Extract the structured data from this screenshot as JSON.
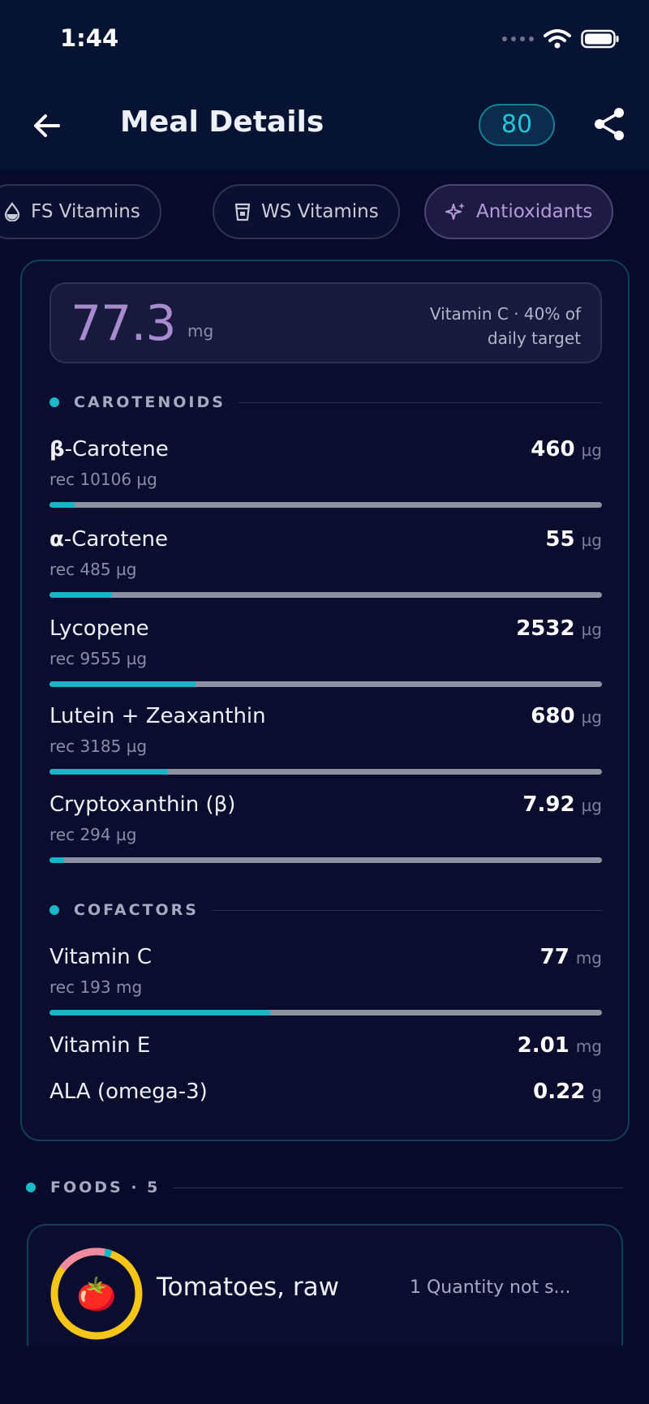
{
  "status_bar": {
    "time": "1:44"
  },
  "header": {
    "title": "Meal Details",
    "score": "80"
  },
  "tabs": [
    {
      "label": "FS Vitamins",
      "icon": "drop-icon"
    },
    {
      "label": "WS Vitamins",
      "icon": "cup-icon"
    },
    {
      "label": "Antioxidants",
      "icon": "sparkle-icon",
      "active": true
    }
  ],
  "summary": {
    "value": "77.3",
    "unit": "mg",
    "caption_line1": "Vitamin C · 40% of",
    "caption_line2": "daily target"
  },
  "sections": {
    "carotenoids": "CAROTENOIDS",
    "cofactors": "COFACTORS",
    "foods": "FOODS · 5"
  },
  "carotenoids": [
    {
      "name_prefix": "β",
      "name_rest": "-Carotene",
      "value": "460",
      "unit": "µg",
      "rec": "rec 10106 µg",
      "progress": 0.046
    },
    {
      "name_prefix": "α",
      "name_rest": "-Carotene",
      "value": "55",
      "unit": "µg",
      "rec": "rec 485 µg",
      "progress": 0.113
    },
    {
      "name_prefix": "",
      "name_rest": "Lycopene",
      "value": "2532",
      "unit": "µg",
      "rec": "rec 9555 µg",
      "progress": 0.265
    },
    {
      "name_prefix": "",
      "name_rest": "Lutein + Zeaxanthin",
      "value": "680",
      "unit": "µg",
      "rec": "rec 3185 µg",
      "progress": 0.214
    },
    {
      "name_prefix": "",
      "name_rest": "Cryptoxanthin (β)",
      "value": "7.92",
      "unit": "µg",
      "rec": "rec 294 µg",
      "progress": 0.027
    }
  ],
  "cofactors": [
    {
      "name": "Vitamin C",
      "value": "77",
      "unit": "mg",
      "rec": "rec 193 mg",
      "progress": 0.4
    },
    {
      "name": "Vitamin E",
      "value": "2.01",
      "unit": "mg"
    },
    {
      "name": "ALA (omega-3)",
      "value": "0.22",
      "unit": "g"
    }
  ],
  "foods": [
    {
      "name": "Tomatoes, raw",
      "quantity": "1 Quantity not s...",
      "emoji": "🍅"
    }
  ],
  "colors": {
    "accent": "#18b4c8",
    "purple": "#a88ad0",
    "ring_yellow": "#f5c518",
    "ring_pink": "#f08aa0"
  }
}
